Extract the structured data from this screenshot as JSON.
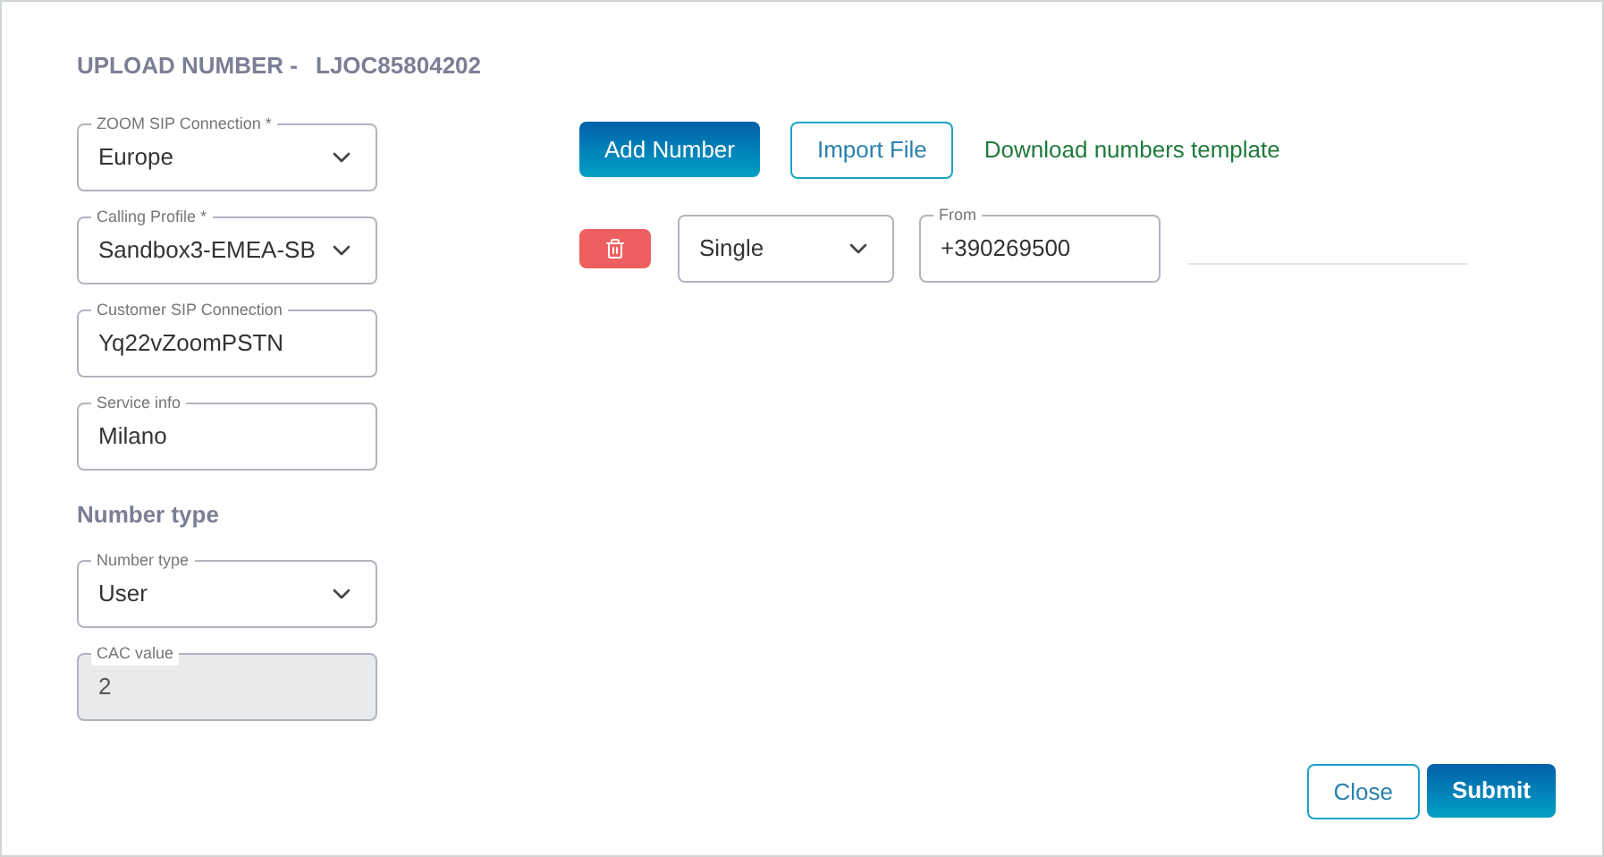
{
  "title": {
    "prefix": "UPLOAD NUMBER -",
    "code": "LJOC85804202"
  },
  "fields": [
    {
      "kind": "select",
      "label": "ZOOM SIP Connection *",
      "value": "Europe",
      "disabled": false
    },
    {
      "kind": "select",
      "label": "Calling Profile *",
      "value": "Sandbox3-EMEA-SB",
      "disabled": false
    },
    {
      "kind": "input",
      "label": "Customer SIP Connection",
      "value": "Yq22vZoomPSTN",
      "disabled": false
    },
    {
      "kind": "input",
      "label": "Service info",
      "value": "Milano",
      "disabled": false
    }
  ],
  "number_type_heading": "Number type",
  "number_type_fields": [
    {
      "kind": "select",
      "label": "Number type",
      "value": "User",
      "disabled": false
    },
    {
      "kind": "input",
      "label": "CAC value",
      "value": "2",
      "disabled": true
    }
  ],
  "actions": {
    "add": "Add Number",
    "import": "Import File",
    "template_link": "Download numbers template"
  },
  "numbers": [
    {
      "type": "Single",
      "from_label": "From",
      "from": "+390269500"
    }
  ],
  "footer": {
    "close": "Close",
    "submit": "Submit"
  }
}
